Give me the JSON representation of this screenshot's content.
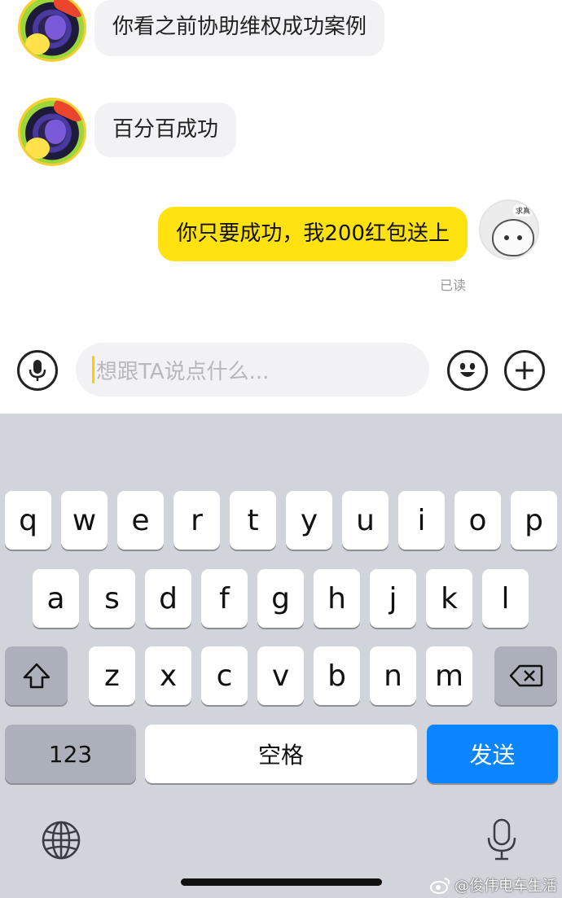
{
  "chat": {
    "messages": [
      {
        "side": "incoming",
        "text": "你看之前协助维权成功案例"
      },
      {
        "side": "incoming",
        "text": "百分百成功"
      },
      {
        "side": "outgoing",
        "text": "你只要成功，我200红包送上"
      }
    ],
    "read_status": "已读",
    "my_avatar_tag": "求真"
  },
  "input": {
    "placeholder": "想跟TA说点什么..."
  },
  "keyboard": {
    "row1": [
      "q",
      "w",
      "e",
      "r",
      "t",
      "y",
      "u",
      "i",
      "o",
      "p"
    ],
    "row2": [
      "a",
      "s",
      "d",
      "f",
      "g",
      "h",
      "j",
      "k",
      "l"
    ],
    "row3": [
      "z",
      "x",
      "c",
      "v",
      "b",
      "n",
      "m"
    ],
    "numbers_label": "123",
    "space_label": "空格",
    "send_label": "发送"
  },
  "watermark": {
    "text": "@俊伟电车生活"
  },
  "colors": {
    "outgoing_bubble": "#ffe20f",
    "incoming_bubble": "#f2f2f4",
    "send_key": "#0a84ff",
    "keyboard_bg": "#d2d4dc"
  }
}
